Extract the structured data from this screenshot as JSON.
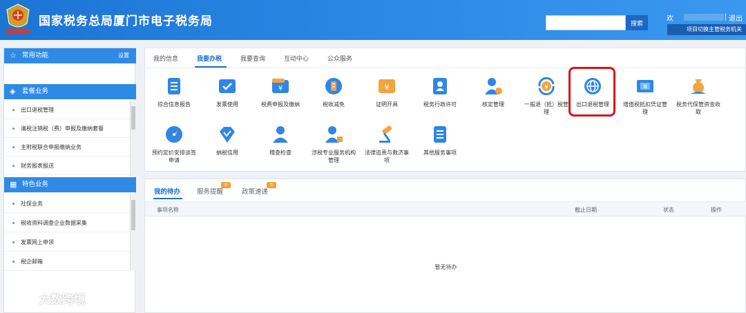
{
  "header": {
    "title": "国家税务总局厦门市电子税务局",
    "search_placeholder": "",
    "search_button": "搜索",
    "welcome": "欢",
    "logout": "退出",
    "switch_org": "项目切换主管税务机关"
  },
  "sidebar": {
    "common": {
      "title": "常用功能",
      "setting": "设置"
    },
    "package": {
      "title": "套餐业务",
      "items": [
        "出口退税管理",
        "清税注销税（费）申报及缴纳套餐",
        "主附税联合申报缴纳业务",
        "财务报表报送"
      ]
    },
    "special": {
      "title": "特色业务",
      "items": [
        "社保业务",
        "税收资料调查企业数据采集",
        "发票网上申领",
        "税企邮箱"
      ]
    }
  },
  "main": {
    "tabs": [
      "我的信息",
      "我要办税",
      "我要查询",
      "互动中心",
      "公众服务"
    ],
    "active_tab": "我要办税",
    "functions": [
      {
        "label": "综合信息报告",
        "icon": "report-icon"
      },
      {
        "label": "发票使用",
        "icon": "invoice-icon"
      },
      {
        "label": "税费申报及缴纳",
        "icon": "tax-payment-icon"
      },
      {
        "label": "税收减免",
        "icon": "tax-relief-icon"
      },
      {
        "label": "证明开具",
        "icon": "certificate-icon"
      },
      {
        "label": "税务行政许可",
        "icon": "permit-icon"
      },
      {
        "label": "核定管理",
        "icon": "verify-user-icon"
      },
      {
        "label": "一般退（抵）税管理",
        "icon": "refund-icon"
      },
      {
        "label": "出口退税管理",
        "icon": "globe-icon"
      },
      {
        "label": "增值税抵扣凭证管理",
        "icon": "vat-voucher-icon"
      },
      {
        "label": "税务代保管资金收取",
        "icon": "money-bag-icon"
      },
      {
        "label": "预约定价安排谈签申请",
        "icon": "compass-icon"
      },
      {
        "label": "纳税信用",
        "icon": "diamond-icon"
      },
      {
        "label": "稽查检查",
        "icon": "inspector-icon"
      },
      {
        "label": "涉税专业服务机构管理",
        "icon": "agency-icon"
      },
      {
        "label": "法律追责与救济事项",
        "icon": "gavel-icon"
      },
      {
        "label": "其他服务事项",
        "icon": "list-icon"
      }
    ],
    "highlighted": "出口退税管理"
  },
  "todo": {
    "tabs": [
      {
        "label": "我的待办",
        "badge": ""
      },
      {
        "label": "服务提醒",
        "badge": "0"
      },
      {
        "label": "政策速递",
        "badge": "0"
      }
    ],
    "columns": [
      "事项名称",
      "截止日期",
      "状态",
      "操作"
    ],
    "empty_text": "暂无待办"
  },
  "watermark": {
    "text": "大数跨境"
  },
  "colors": {
    "header_blue": "#2a84e2",
    "accent": "#1a6fd0",
    "highlight_red": "#d6141c",
    "badge_orange": "#f2a33a"
  }
}
